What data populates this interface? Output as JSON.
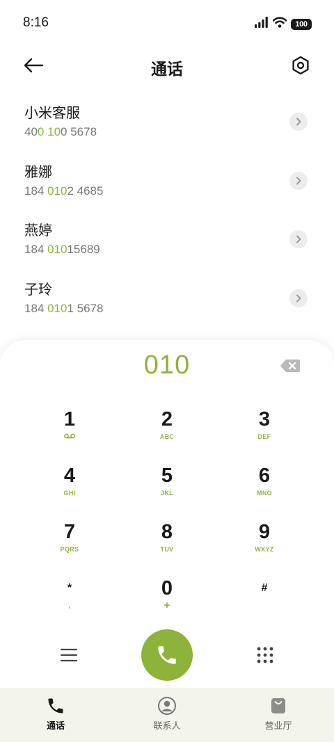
{
  "status_bar": {
    "time": "8:16",
    "battery": "100"
  },
  "header": {
    "title": "通话"
  },
  "contacts": [
    {
      "name": "小米客服",
      "number_parts": [
        {
          "text": "40",
          "hl": false
        },
        {
          "text": "0",
          "hl": true
        },
        {
          "text": " ",
          "hl": false
        },
        {
          "text": "10",
          "hl": true
        },
        {
          "text": "0 5678",
          "hl": false
        }
      ]
    },
    {
      "name": "雅娜",
      "number_parts": [
        {
          "text": "184 ",
          "hl": false
        },
        {
          "text": "010",
          "hl": true
        },
        {
          "text": "2 4685",
          "hl": false
        }
      ]
    },
    {
      "name": "燕婷",
      "number_parts": [
        {
          "text": "184 ",
          "hl": false
        },
        {
          "text": "010",
          "hl": true
        },
        {
          "text": "15689",
          "hl": false
        }
      ]
    },
    {
      "name": "子玲",
      "number_parts": [
        {
          "text": "184 ",
          "hl": false
        },
        {
          "text": "010",
          "hl": true
        },
        {
          "text": "1 5678",
          "hl": false
        }
      ]
    }
  ],
  "dialer": {
    "input_value": "010",
    "keys": [
      {
        "digit": "1",
        "sub": "voicemail"
      },
      {
        "digit": "2",
        "sub": "ABC"
      },
      {
        "digit": "3",
        "sub": "DEF"
      },
      {
        "digit": "4",
        "sub": "GHI"
      },
      {
        "digit": "5",
        "sub": "JKL"
      },
      {
        "digit": "6",
        "sub": "MNO"
      },
      {
        "digit": "7",
        "sub": "PQRS"
      },
      {
        "digit": "8",
        "sub": "TUV"
      },
      {
        "digit": "9",
        "sub": "WXYZ"
      },
      {
        "digit": "*",
        "sub": ","
      },
      {
        "digit": "0",
        "sub": "+"
      },
      {
        "digit": "#",
        "sub": ""
      }
    ]
  },
  "bottom_nav": {
    "items": [
      {
        "label": "通话",
        "icon": "phone-icon",
        "active": true
      },
      {
        "label": "联系人",
        "icon": "contact-icon",
        "active": false
      },
      {
        "label": "营业厅",
        "icon": "shopping-bag-icon",
        "active": false
      }
    ]
  },
  "colors": {
    "accent": "#8db33a",
    "text": "#1a1a1a",
    "secondary_text": "#777777",
    "nav_background": "#f3f4ea"
  }
}
